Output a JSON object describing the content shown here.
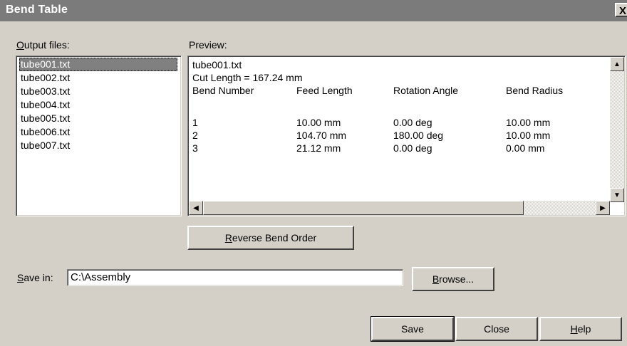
{
  "window": {
    "title": "Bend Table",
    "close_glyph": "X"
  },
  "output_files": {
    "label_mnemonic": "O",
    "label_rest": "utput files:",
    "items": [
      "tube001.txt",
      "tube002.txt",
      "tube003.txt",
      "tube004.txt",
      "tube005.txt",
      "tube006.txt",
      "tube007.txt"
    ],
    "selected_index": 0
  },
  "preview": {
    "label": "Preview:",
    "filename": "tube001.txt",
    "cut_length": "Cut Length = 167.24 mm",
    "columns": [
      "Bend Number",
      "Feed Length",
      "Rotation Angle",
      "Bend Radius"
    ],
    "rows": [
      [
        "1",
        "10.00 mm",
        "0.00 deg",
        "10.00 mm"
      ],
      [
        "2",
        "104.70 mm",
        "180.00 deg",
        "10.00 mm"
      ],
      [
        "3",
        "21.12 mm",
        "0.00 deg",
        "0.00 mm"
      ]
    ]
  },
  "reverse_button": {
    "mnemonic": "R",
    "rest": "everse Bend Order"
  },
  "save_in": {
    "label_mnemonic": "S",
    "label_rest": "ave in:",
    "value": "C:\\Assembly"
  },
  "browse_button": {
    "mnemonic": "B",
    "rest": "rowse..."
  },
  "footer": {
    "save_label": "Save",
    "close_label": "Close",
    "help_mnemonic": "H",
    "help_rest": "elp"
  },
  "icons": {
    "scroll_up": "▲",
    "scroll_down": "▼",
    "scroll_left": "◀",
    "scroll_right": "▶"
  }
}
